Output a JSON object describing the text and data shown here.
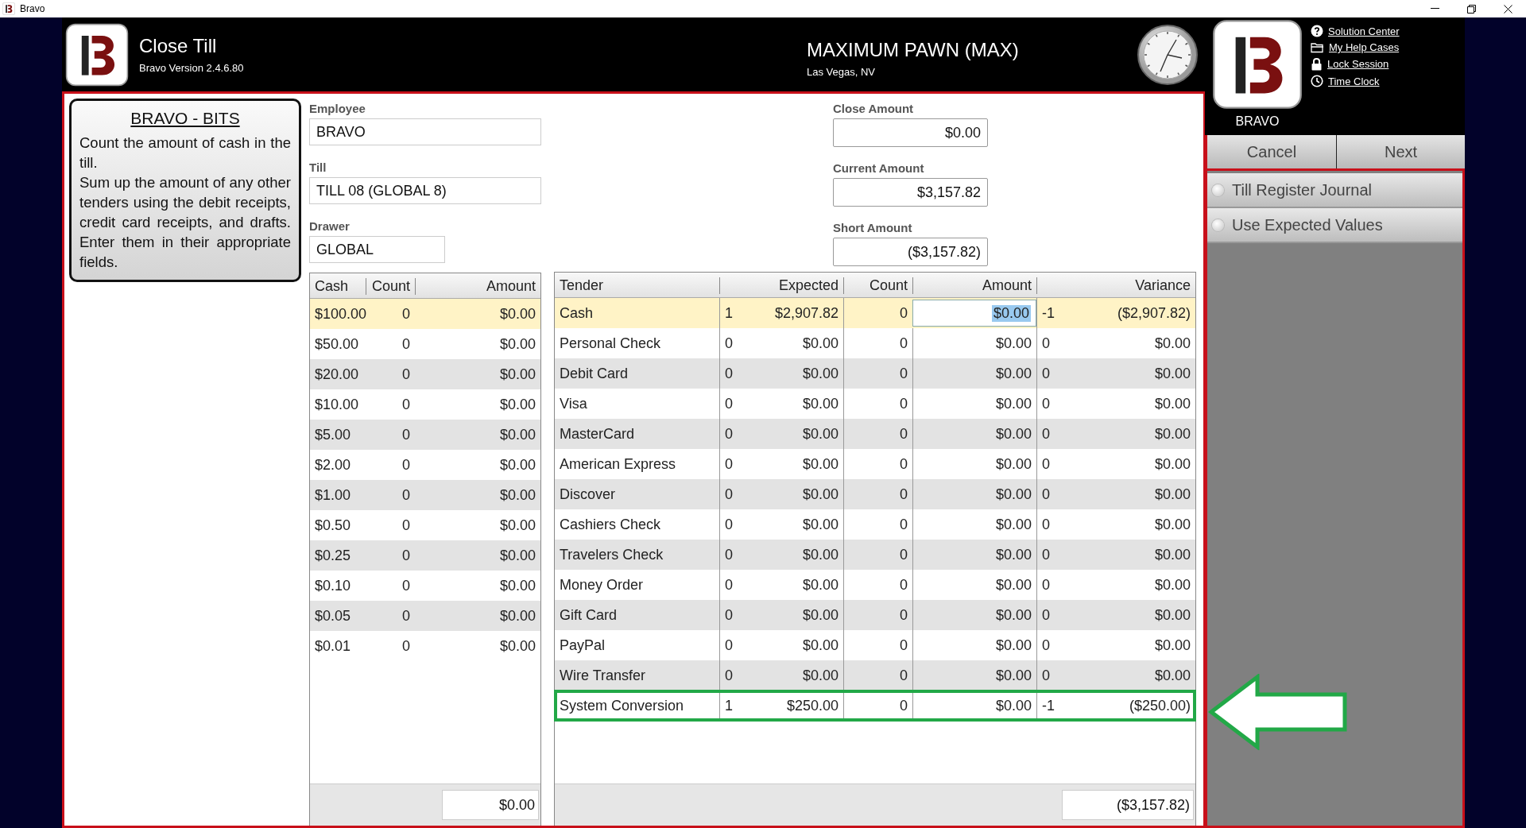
{
  "window": {
    "title": "Bravo"
  },
  "header": {
    "title": "Close Till",
    "version": "Bravo Version 2.4.6.80",
    "store": "MAXIMUM PAWN (MAX)",
    "location": "Las Vegas, NV"
  },
  "user": {
    "name": "BRAVO",
    "links": [
      {
        "label": "Solution Center",
        "kind": "help"
      },
      {
        "label": "My Help Cases",
        "kind": "folder"
      },
      {
        "label": "Lock Session",
        "kind": "lock"
      },
      {
        "label": "Time Clock",
        "kind": "clock"
      }
    ]
  },
  "actions": [
    "Cancel",
    "Next"
  ],
  "options": [
    {
      "label": "Till Register Journal",
      "checked": false
    },
    {
      "label": "Use Expected Values",
      "checked": false
    }
  ],
  "tip": {
    "title": "BRAVO - BITS",
    "paragraphs": [
      "Count the amount of cash in the till.",
      "Sum up the amount of any other tenders using the debit receipts, credit card receipts, and drafts. Enter them in their appropriate fields."
    ]
  },
  "fields": [
    {
      "label": "Employee",
      "value": "BRAVO",
      "kind": "wide"
    },
    {
      "label": "Till",
      "value": "TILL 08 (GLOBAL 8)",
      "kind": "wide"
    },
    {
      "label": "Drawer",
      "value": "GLOBAL",
      "kind": "narrow"
    }
  ],
  "amounts": [
    {
      "label": "Close Amount",
      "value": "$0.00"
    },
    {
      "label": "Current Amount",
      "value": "$3,157.82"
    },
    {
      "label": "Short Amount",
      "value": "($3,157.82)"
    }
  ],
  "cash_table": {
    "columns": [
      "Cash",
      "Count",
      "Amount"
    ],
    "rows": [
      {
        "cells": [
          "$100.00",
          "0",
          "$0.00"
        ],
        "selected": true
      },
      {
        "cells": [
          "$50.00",
          "0",
          "$0.00"
        ],
        "selected": false
      },
      {
        "cells": [
          "$20.00",
          "0",
          "$0.00"
        ],
        "selected": false
      },
      {
        "cells": [
          "$10.00",
          "0",
          "$0.00"
        ],
        "selected": false
      },
      {
        "cells": [
          "$5.00",
          "0",
          "$0.00"
        ],
        "selected": false
      },
      {
        "cells": [
          "$2.00",
          "0",
          "$0.00"
        ],
        "selected": false
      },
      {
        "cells": [
          "$1.00",
          "0",
          "$0.00"
        ],
        "selected": false
      },
      {
        "cells": [
          "$0.50",
          "0",
          "$0.00"
        ],
        "selected": false
      },
      {
        "cells": [
          "$0.25",
          "0",
          "$0.00"
        ],
        "selected": false
      },
      {
        "cells": [
          "$0.10",
          "0",
          "$0.00"
        ],
        "selected": false
      },
      {
        "cells": [
          "$0.05",
          "0",
          "$0.00"
        ],
        "selected": false
      },
      {
        "cells": [
          "$0.01",
          "0",
          "$0.00"
        ],
        "selected": false
      }
    ],
    "total": "$0.00"
  },
  "tender_table": {
    "columns": [
      "Tender",
      "Expected",
      "Count",
      "Amount",
      "Variance"
    ],
    "rows": [
      {
        "cells": [
          "Cash",
          [
            "1",
            "$2,907.82"
          ],
          "0",
          "$0.00",
          [
            "-1",
            "($2,907.82)"
          ]
        ],
        "selected": true,
        "highlighted": false
      },
      {
        "cells": [
          "Personal Check",
          [
            "0",
            "$0.00"
          ],
          "0",
          "$0.00",
          [
            "0",
            "$0.00"
          ]
        ],
        "selected": false,
        "highlighted": false
      },
      {
        "cells": [
          "Debit Card",
          [
            "0",
            "$0.00"
          ],
          "0",
          "$0.00",
          [
            "0",
            "$0.00"
          ]
        ],
        "selected": false,
        "highlighted": false
      },
      {
        "cells": [
          "Visa",
          [
            "0",
            "$0.00"
          ],
          "0",
          "$0.00",
          [
            "0",
            "$0.00"
          ]
        ],
        "selected": false,
        "highlighted": false
      },
      {
        "cells": [
          "MasterCard",
          [
            "0",
            "$0.00"
          ],
          "0",
          "$0.00",
          [
            "0",
            "$0.00"
          ]
        ],
        "selected": false,
        "highlighted": false
      },
      {
        "cells": [
          "American Express",
          [
            "0",
            "$0.00"
          ],
          "0",
          "$0.00",
          [
            "0",
            "$0.00"
          ]
        ],
        "selected": false,
        "highlighted": false
      },
      {
        "cells": [
          "Discover",
          [
            "0",
            "$0.00"
          ],
          "0",
          "$0.00",
          [
            "0",
            "$0.00"
          ]
        ],
        "selected": false,
        "highlighted": false
      },
      {
        "cells": [
          "Cashiers Check",
          [
            "0",
            "$0.00"
          ],
          "0",
          "$0.00",
          [
            "0",
            "$0.00"
          ]
        ],
        "selected": false,
        "highlighted": false
      },
      {
        "cells": [
          "Travelers Check",
          [
            "0",
            "$0.00"
          ],
          "0",
          "$0.00",
          [
            "0",
            "$0.00"
          ]
        ],
        "selected": false,
        "highlighted": false
      },
      {
        "cells": [
          "Money Order",
          [
            "0",
            "$0.00"
          ],
          "0",
          "$0.00",
          [
            "0",
            "$0.00"
          ]
        ],
        "selected": false,
        "highlighted": false
      },
      {
        "cells": [
          "Gift Card",
          [
            "0",
            "$0.00"
          ],
          "0",
          "$0.00",
          [
            "0",
            "$0.00"
          ]
        ],
        "selected": false,
        "highlighted": false
      },
      {
        "cells": [
          "PayPal",
          [
            "0",
            "$0.00"
          ],
          "0",
          "$0.00",
          [
            "0",
            "$0.00"
          ]
        ],
        "selected": false,
        "highlighted": false
      },
      {
        "cells": [
          "Wire Transfer",
          [
            "0",
            "$0.00"
          ],
          "0",
          "$0.00",
          [
            "0",
            "$0.00"
          ]
        ],
        "selected": false,
        "highlighted": false
      },
      {
        "cells": [
          "System Conversion",
          [
            "1",
            "$250.00"
          ],
          "0",
          "$0.00",
          [
            "-1",
            "($250.00)"
          ]
        ],
        "selected": false,
        "highlighted": true
      }
    ],
    "total": "($3,157.82)"
  }
}
